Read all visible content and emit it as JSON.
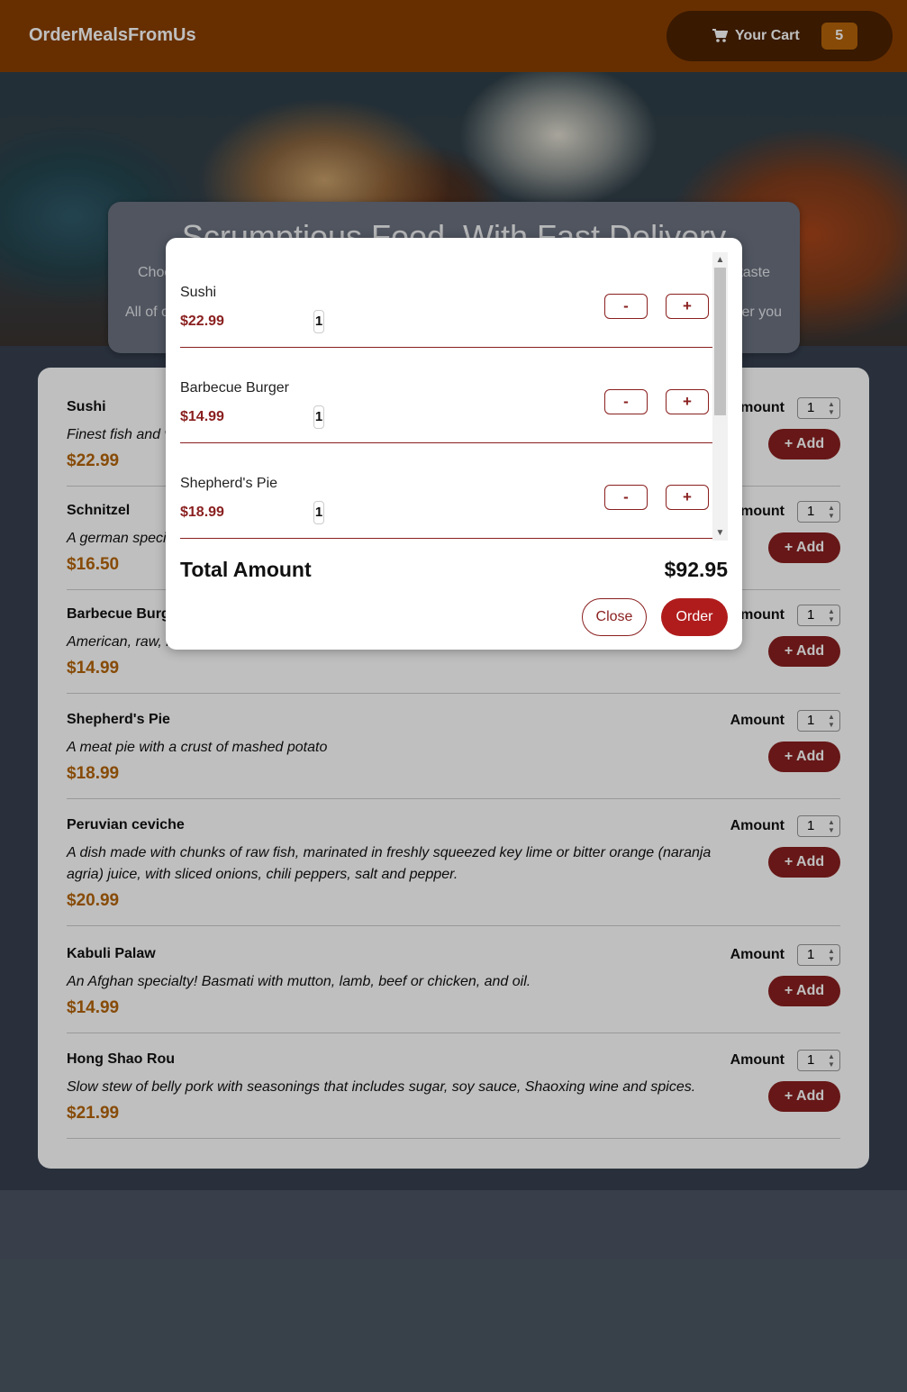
{
  "header": {
    "brand": "OrderMealsFromUs",
    "cart_label": "Your Cart",
    "cart_count": "5"
  },
  "hero": {
    "title": "Scrumptious Food, With Fast Delivery",
    "p1_left": "Choo",
    "p1_right": "taste",
    "p2_left": "All of o",
    "p2_right": "er you"
  },
  "meals": [
    {
      "name": "Sushi",
      "description": "Finest fish and veggies",
      "price": "$22.99"
    },
    {
      "name": "Schnitzel",
      "description": "A german specialty!",
      "price": "$16.50"
    },
    {
      "name": "Barbecue Burger",
      "description": "American, raw, meaty",
      "price": "$14.99"
    },
    {
      "name": "Shepherd's Pie",
      "description": "A meat pie with a crust of mashed potato",
      "price": "$18.99"
    },
    {
      "name": "Peruvian ceviche",
      "description": "A dish made with chunks of raw fish, marinated in freshly squeezed key lime or bitter orange (naranja agria) juice, with sliced onions, chili peppers, salt and pepper.",
      "price": "$20.99"
    },
    {
      "name": "Kabuli Palaw",
      "description": "An Afghan specialty! Basmati with mutton, lamb, beef or chicken, and oil.",
      "price": "$14.99"
    },
    {
      "name": "Hong Shao Rou",
      "description": "Slow stew of belly pork with seasonings that includes sugar, soy sauce, Shaoxing wine and spices.",
      "price": "$21.99"
    }
  ],
  "meal_form": {
    "amount_label": "Amount",
    "amount_value": "1",
    "add_label": "+ Add"
  },
  "cart": {
    "items": [
      {
        "name": "Sushi",
        "price": "$22.99",
        "qty": "1"
      },
      {
        "name": "Barbecue Burger",
        "price": "$14.99",
        "qty": "1"
      },
      {
        "name": "Shepherd's Pie",
        "price": "$18.99",
        "qty": "1"
      }
    ],
    "minus_label": "-",
    "plus_label": "+",
    "total_label": "Total Amount",
    "total_value": "$92.95",
    "close_label": "Close",
    "order_label": "Order"
  },
  "icons": {
    "cart": "cart-icon",
    "scroll_up": "chevron-up-icon",
    "scroll_down": "chevron-down-icon"
  },
  "colors": {
    "header": "#8a3f00",
    "accent": "#8a1f1f",
    "price": "#b5650a",
    "order": "#b01c1c"
  }
}
